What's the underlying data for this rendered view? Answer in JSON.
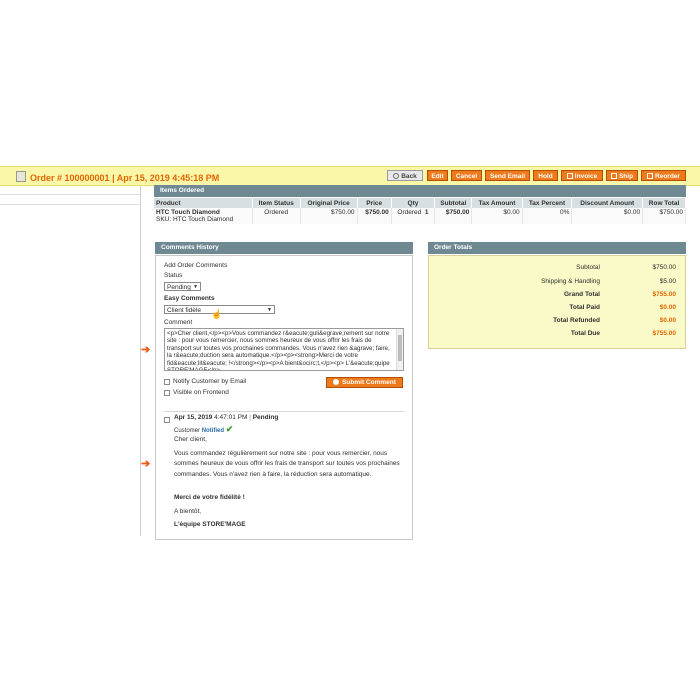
{
  "header": {
    "title": "Order # 100000001 | Apr 15, 2019 4:45:18 PM",
    "buttons": {
      "back": "Back",
      "edit": "Edit",
      "cancel": "Cancel",
      "send_email": "Send Email",
      "hold": "Hold",
      "invoice": "Invoice",
      "ship": "Ship",
      "reorder": "Reorder"
    }
  },
  "items_ordered": {
    "title": "Items Ordered",
    "columns": [
      "Product",
      "Item Status",
      "Original Price",
      "Price",
      "Qty",
      "Subtotal",
      "Tax Amount",
      "Tax Percent",
      "Discount Amount",
      "Row Total"
    ],
    "row": {
      "product": "HTC Touch Diamond",
      "sku": "SKU: HTC Touch Diamond",
      "item_status": "Ordered",
      "original_price": "$750.00",
      "price": "$750.00",
      "qty_label": "Ordered",
      "qty_value": "1",
      "subtotal": "$750.00",
      "tax_amount": "$0.00",
      "tax_percent": "0%",
      "discount_amount": "$0.00",
      "row_total": "$750.00"
    }
  },
  "comments": {
    "title": "Comments History",
    "add_label": "Add Order Comments",
    "status_label": "Status",
    "status_value": "Pending",
    "easy_label": "Easy Comments",
    "easy_value": "Client fidèle",
    "comment_label": "Comment",
    "comment_text": "<p>Cher client,</p><p>Vous commandez r&eacute;guli&egrave;rement sur notre site : pour vous remercier, nous sommes heureux de vous offrir les frais de transport sur toutes vos prochaines commandes. Vous n'avez rien &agrave; faire, la r&eacute;duction sera automatique.</p><p><strong>Merci de votre fid&eacute;lit&eacute; !</strong></p><p>A bient&ocirc;t,</p><p> L'&eacute;quipe STORE'MAGE</p>",
    "notify_label": "Notify Customer by Email",
    "visible_label": "Visible on Frontend",
    "submit_label": "Submit Comment",
    "entry": {
      "date": "Apr 15, 2019",
      "time": "4:47:01 PM",
      "separator": "|",
      "status": "Pending",
      "customer_label": "Customer",
      "notified_label": "Notified",
      "greeting": "Cher client,",
      "body": "Vous commandez régulièrement sur notre site : pour vous remercier, nous sommes heureux de vous offrir les frais de transport sur toutes vos prochaines commandes. Vous n'avez rien à faire, la réduction sera automatique.",
      "thanks": "Merci de votre fidélité !",
      "bye": "A bientôt,",
      "signature": "L'équipe STORE'MAGE"
    }
  },
  "totals": {
    "title": "Order Totals",
    "rows": [
      {
        "label": "Subtotal",
        "value": "$750.00"
      },
      {
        "label": "Shipping & Handling",
        "value": "$5.00"
      },
      {
        "label": "Grand Total",
        "value": "$755.00"
      },
      {
        "label": "Total Paid",
        "value": "$0.00"
      },
      {
        "label": "Total Refunded",
        "value": "$0.00"
      },
      {
        "label": "Total Due",
        "value": "$755.00"
      }
    ]
  },
  "colors": {
    "accent": "#ee7a1c",
    "header_bg": "#faf7a8",
    "section_head": "#6f8992",
    "totals_bg": "#fafac8"
  }
}
